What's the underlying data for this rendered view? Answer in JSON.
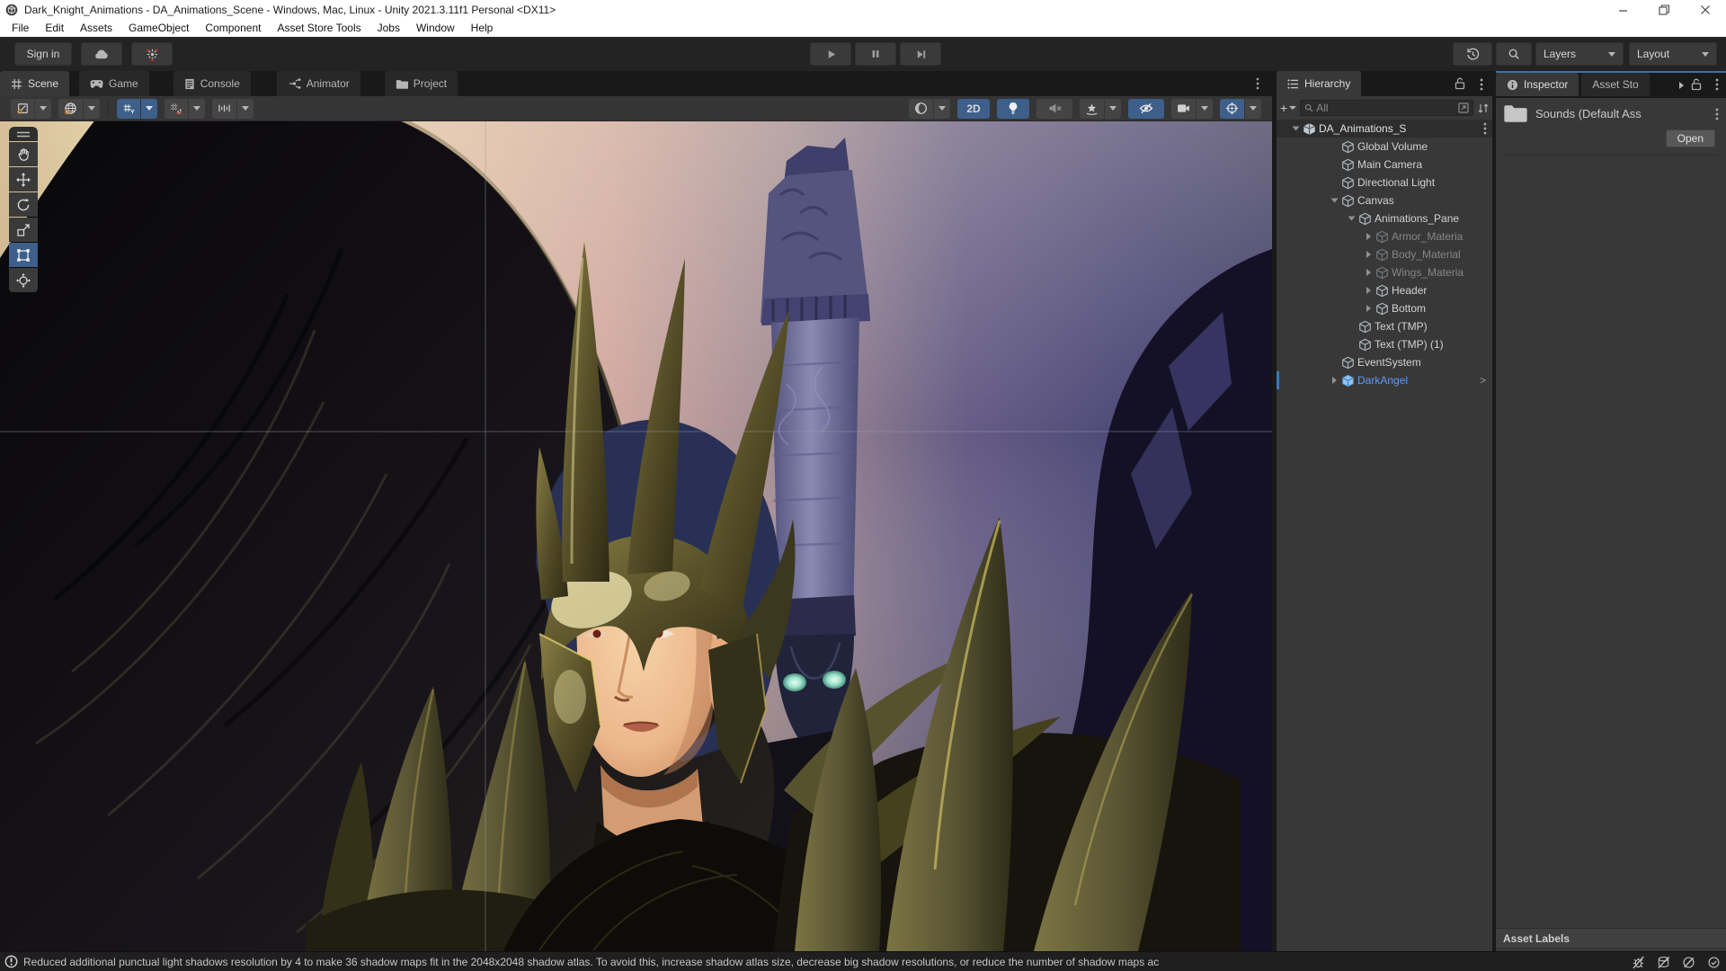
{
  "window": {
    "title": "Dark_Knight_Animations - DA_Animations_Scene - Windows, Mac, Linux - Unity 2021.3.11f1 Personal <DX11>"
  },
  "menu_bar": {
    "items": [
      "File",
      "Edit",
      "Assets",
      "GameObject",
      "Component",
      "Asset Store Tools",
      "Jobs",
      "Window",
      "Help"
    ]
  },
  "toolbar": {
    "sign_in": "Sign in",
    "layers": "Layers",
    "layout": "Layout"
  },
  "view_tabs": {
    "scene": {
      "label": "Scene"
    },
    "game": {
      "label": "Game"
    },
    "console": {
      "label": "Console"
    },
    "animator": {
      "label": "Animator"
    },
    "project": {
      "label": "Project"
    }
  },
  "scene_toolbar": {
    "mode_2d": "2D"
  },
  "hierarchy": {
    "tab_label": "Hierarchy",
    "search_placeholder": "All",
    "items": [
      {
        "label": "DA_Animations_S",
        "type": "scene",
        "depth": 0,
        "arrow": "expanded",
        "kebab": true
      },
      {
        "label": "Global Volume",
        "type": "object",
        "depth": 1
      },
      {
        "label": "Main Camera",
        "type": "object",
        "depth": 1
      },
      {
        "label": "Directional Light",
        "type": "object",
        "depth": 1
      },
      {
        "label": "Canvas",
        "type": "object",
        "depth": 1,
        "arrow": "expanded"
      },
      {
        "label": "Animations_Pane",
        "type": "object",
        "depth": 2,
        "arrow": "expanded"
      },
      {
        "label": "Armor_Materia",
        "type": "object",
        "depth": 3,
        "arrow": "collapsed",
        "dimmed": true
      },
      {
        "label": "Body_Material",
        "type": "object",
        "depth": 3,
        "arrow": "collapsed",
        "dimmed": true
      },
      {
        "label": "Wings_Materia",
        "type": "object",
        "depth": 3,
        "arrow": "collapsed",
        "dimmed": true
      },
      {
        "label": "Header",
        "type": "object",
        "depth": 3,
        "arrow": "collapsed"
      },
      {
        "label": "Bottom",
        "type": "object",
        "depth": 3,
        "arrow": "collapsed"
      },
      {
        "label": "Text (TMP)",
        "type": "object",
        "depth": 2
      },
      {
        "label": "Text (TMP) (1)",
        "type": "object",
        "depth": 2
      },
      {
        "label": "EventSystem",
        "type": "object",
        "depth": 1
      },
      {
        "label": "DarkAngel",
        "type": "prefab",
        "depth": 1,
        "arrow": "collapsed",
        "selected_marker": true,
        "chevron": ">"
      }
    ]
  },
  "inspector": {
    "tab_label": "Inspector",
    "tab_asset_store": "Asset Sto",
    "header_title": "Sounds (Default Ass",
    "open_button": "Open",
    "asset_labels_label": "Asset Labels"
  },
  "status_bar": {
    "message": "Reduced additional punctual light shadows resolution by 4 to make 36 shadow maps fit in the 2048x2048 shadow atlas. To avoid this, increase shadow atlas size, decrease big shadow resolutions, or reduce the number of shadow maps ac"
  },
  "colors": {
    "toggle_blue": "#3e5f8a",
    "selection_blue": "#5a9cf8",
    "panel_bg": "#383838",
    "dark_bg": "#191919"
  }
}
